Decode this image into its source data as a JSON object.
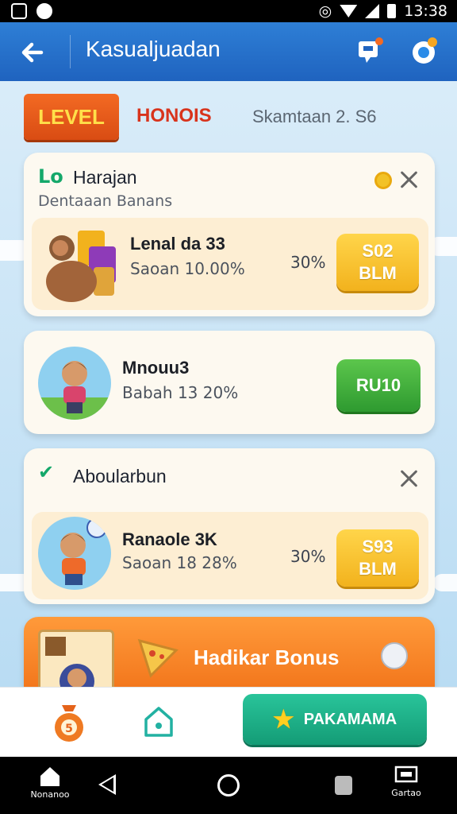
{
  "status_bar": {
    "time": "13:38"
  },
  "app_bar": {
    "title": "Kasualjuadan"
  },
  "tabs": {
    "level": "LEVEL",
    "bonus": "HONOIS",
    "info": "Skamtaan 2. S6"
  },
  "cards": [
    {
      "head_icon": "Lo",
      "title": "Harajan",
      "subtitle": "Dentaaan Banans",
      "row": {
        "name": "Lenal da 33",
        "sub": "Saoan 10.00%",
        "pct": "30%",
        "btn_line1": "S02",
        "btn_line2": "BLM"
      }
    },
    {
      "row": {
        "name": "Mnouu3",
        "sub": "Babah 13 20%",
        "btn": "RU10"
      }
    },
    {
      "head_icon": "✔",
      "title": "Aboularbun",
      "row": {
        "name": "Ranaole 3K",
        "sub": "Saoan 18 28%",
        "pct": "30%",
        "btn_line1": "S93",
        "btn_line2": "BLM"
      }
    }
  ],
  "bonus_banner": {
    "label": "Hadikar Bonus"
  },
  "bottom_bar": {
    "primary_button": "PAKAMAMA"
  },
  "nav_bar": {
    "home_label": "Nonanoo",
    "recent_label": "Gartao"
  },
  "colors": {
    "app_bar": "#1f63bf",
    "accent_orange": "#f06f16",
    "gold_button": "#f2b21d",
    "green_button": "#2e9a30",
    "teal_button": "#149c76"
  }
}
